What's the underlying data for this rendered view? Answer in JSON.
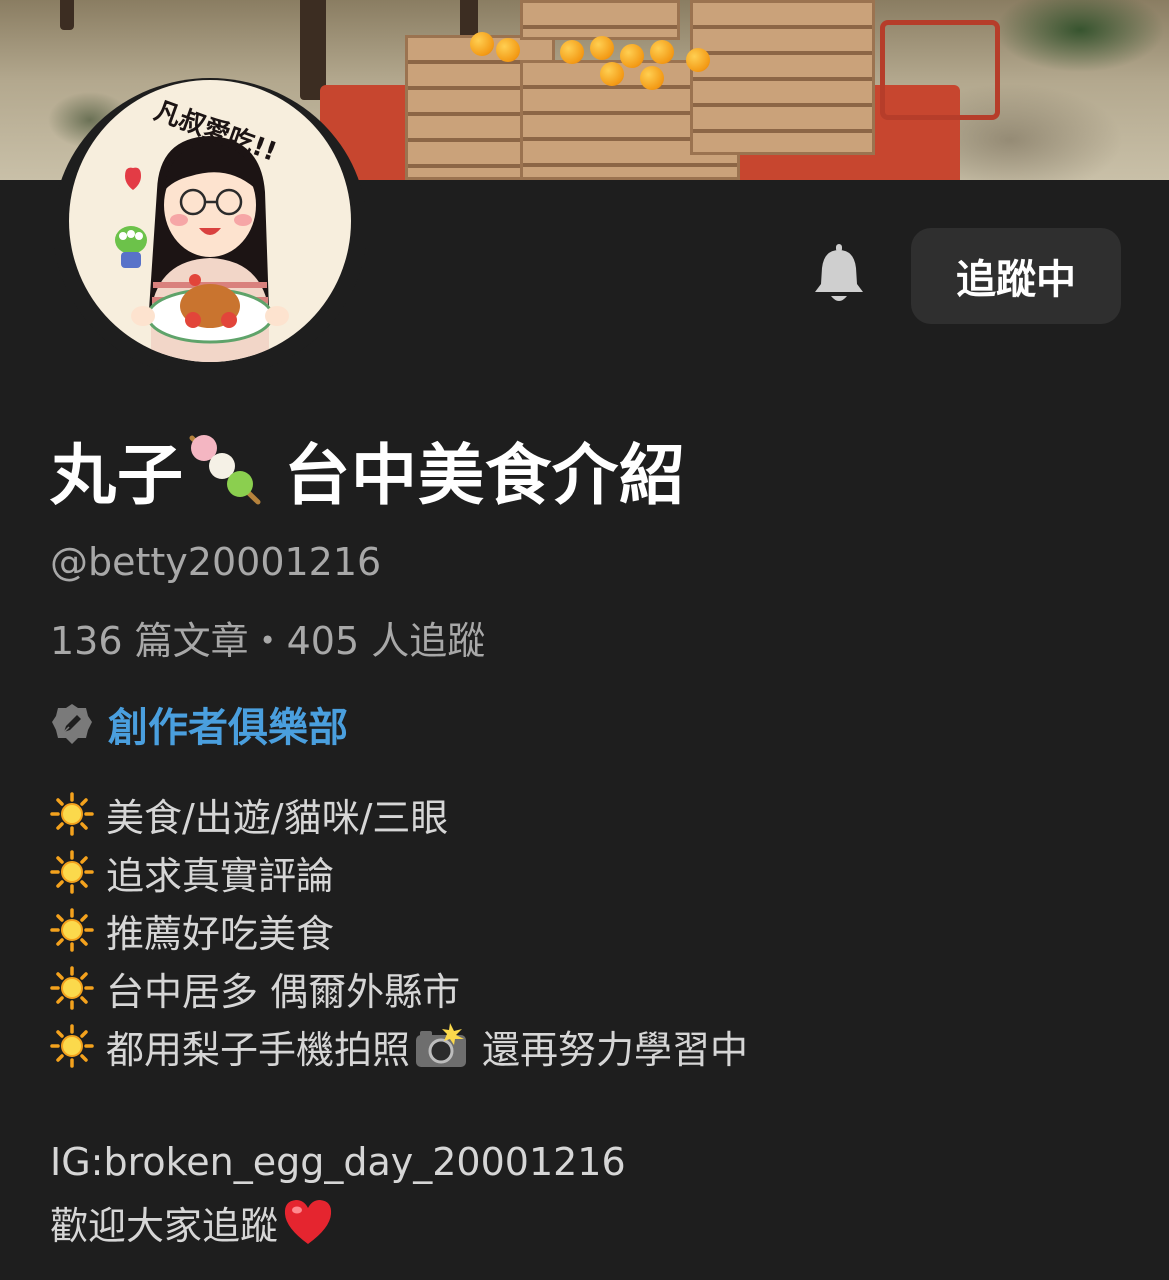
{
  "profile": {
    "name_prefix": "丸子",
    "name_suffix": "台中美食介紹",
    "handle": "@betty20001216",
    "stats": "136 篇文章・405 人追蹤",
    "avatar_text": "凡叔愛吃!!"
  },
  "actions": {
    "follow_label": "追蹤中",
    "bell_icon": "bell-icon"
  },
  "club": {
    "label": "創作者俱樂部",
    "icon": "pen-badge-icon",
    "color": "#4a9fde"
  },
  "bio": {
    "lines": [
      "美食/出遊/貓咪/三眼",
      "追求真實評論",
      "推薦好吃美食",
      "台中居多 偶爾外縣市",
      "都用梨子手機拍照",
      "還再努力學習中"
    ],
    "ig": "IG:broken_egg_day_20001216",
    "welcome": "歡迎大家追蹤",
    "bullet_icon": "sun-icon",
    "camera_icon": "camera-flash-icon",
    "heart_icon": "red-heart-icon"
  },
  "colors": {
    "background": "#1e1e1e",
    "button_bg": "#2f2f2f",
    "secondary_text": "#a8a8a8",
    "bio_text": "#d6d6d6"
  }
}
